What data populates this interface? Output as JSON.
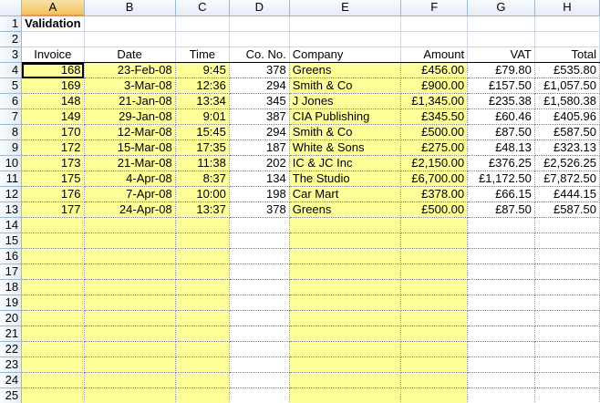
{
  "columns": [
    "A",
    "B",
    "C",
    "D",
    "E",
    "F",
    "G",
    "H"
  ],
  "title": "Validation",
  "headers": [
    "Invoice",
    "Date",
    "Time",
    "Co. No.",
    "Company",
    "Amount",
    "VAT",
    "Total"
  ],
  "rows": [
    [
      "168",
      "23-Feb-08",
      "9:45",
      "378",
      "Greens",
      "£456.00",
      "£79.80",
      "£535.80"
    ],
    [
      "169",
      "3-Mar-08",
      "12:36",
      "294",
      "Smith & Co",
      "£900.00",
      "£157.50",
      "£1,057.50"
    ],
    [
      "148",
      "21-Jan-08",
      "13:34",
      "345",
      "J Jones",
      "£1,345.00",
      "£235.38",
      "£1,580.38"
    ],
    [
      "149",
      "29-Jan-08",
      "9:01",
      "387",
      "CIA Publishing",
      "£345.50",
      "£60.46",
      "£405.96"
    ],
    [
      "170",
      "12-Mar-08",
      "15:45",
      "294",
      "Smith & Co",
      "£500.00",
      "£87.50",
      "£587.50"
    ],
    [
      "172",
      "15-Mar-08",
      "17:35",
      "187",
      "White & Sons",
      "£275.00",
      "£48.13",
      "£323.13"
    ],
    [
      "173",
      "21-Mar-08",
      "11:38",
      "202",
      "IC & JC Inc",
      "£2,150.00",
      "£376.25",
      "£2,526.25"
    ],
    [
      "175",
      "4-Apr-08",
      "8:37",
      "134",
      "The Studio",
      "£6,700.00",
      "£1,172.50",
      "£7,872.50"
    ],
    [
      "176",
      "7-Apr-08",
      "10:00",
      "198",
      "Car Mart",
      "£378.00",
      "£66.15",
      "£444.15"
    ],
    [
      "177",
      "24-Apr-08",
      "13:37",
      "378",
      "Greens",
      "£500.00",
      "£87.50",
      "£587.50"
    ]
  ],
  "empty_row_numbers": [
    "14",
    "15",
    "16",
    "17",
    "18",
    "19",
    "20",
    "21",
    "22",
    "23",
    "24",
    "25"
  ],
  "colors": {
    "input_fill": "#ffff99",
    "header_bg": "#e4ecf7",
    "selected_header": "#f1c15f"
  }
}
